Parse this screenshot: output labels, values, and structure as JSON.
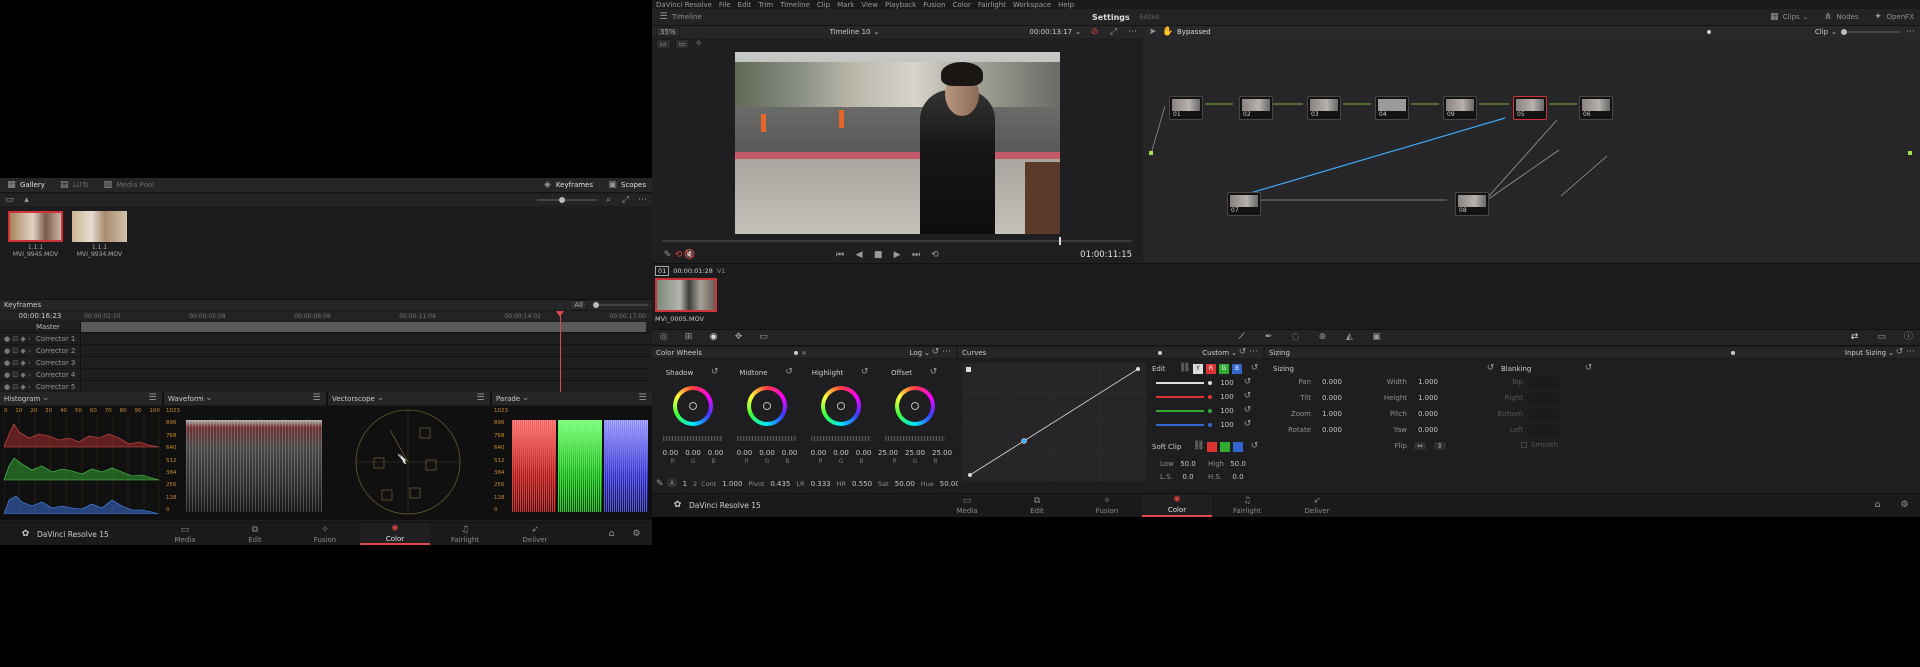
{
  "left": {
    "tabs": {
      "gallery": "Gallery",
      "luts": "LUTs",
      "media_pool": "Media Pool",
      "keyframes": "Keyframes",
      "scopes": "Scopes"
    },
    "stills": [
      {
        "version": "1.1.1",
        "name": "MVI_9945.MOV"
      },
      {
        "version": "1.1.1",
        "name": "MVI_9934.MOV"
      }
    ],
    "keyframes": {
      "title": "Keyframes",
      "filter": "All",
      "timecode": "00:00:16:23",
      "ruler": [
        "00:00:02:10",
        "00:00:05:08",
        "00:00:08:06",
        "00:00:11:04",
        "00:00:14:02",
        "00:00:17:00"
      ],
      "tracks": [
        "Master",
        "Corrector 1",
        "Corrector 2",
        "Corrector 3",
        "Corrector 4",
        "Corrector 5"
      ]
    },
    "scopes": {
      "histogram": "Histogram",
      "waveform": "Waveform",
      "vectorscope": "Vectorscope",
      "parade": "Parade",
      "hist_ticks": [
        "0",
        "10",
        "20",
        "30",
        "40",
        "50",
        "60",
        "70",
        "80",
        "90",
        "100"
      ],
      "y_ticks": [
        "1023",
        "896",
        "768",
        "640",
        "512",
        "384",
        "256",
        "128",
        "0"
      ]
    },
    "app": "DaVinci Resolve 15",
    "pages": [
      "Media",
      "Edit",
      "Fusion",
      "Color",
      "Fairlight",
      "Deliver"
    ]
  },
  "right": {
    "menu": [
      "DaVinci Resolve",
      "File",
      "Edit",
      "Trim",
      "Timeline",
      "Clip",
      "Mark",
      "View",
      "Playback",
      "Fusion",
      "Color",
      "Fairlight",
      "Workspace",
      "Help"
    ],
    "toolbar": {
      "timeline": "Timeline",
      "title": "Settings",
      "edited": "Edited",
      "clips": "Clips",
      "nodes": "Nodes",
      "openfx": "OpenFX"
    },
    "viewer": {
      "zoom": "35%",
      "timeline_name": "Timeline 10",
      "tc": "00:00:13:17",
      "timecode": "01:00:11:15"
    },
    "nodes_panel": {
      "bypassed": "Bypassed",
      "mode": "Clip",
      "nodes": [
        "01",
        "02",
        "03",
        "04",
        "09",
        "05",
        "06",
        "07",
        "08"
      ]
    },
    "clip": {
      "index": "01",
      "tc": "00:00:01:28",
      "track": "V1",
      "name": "MVI_0005.MOV"
    },
    "color_wheels": {
      "title": "Color Wheels",
      "mode": "Log",
      "wheels": [
        {
          "name": "Shadow",
          "vals": [
            "0.00",
            "0.00",
            "0.00"
          ]
        },
        {
          "name": "Midtone",
          "vals": [
            "0.00",
            "0.00",
            "0.00"
          ]
        },
        {
          "name": "Highlight",
          "vals": [
            "0.00",
            "0.00",
            "0.00"
          ]
        },
        {
          "name": "Offset",
          "vals": [
            "25.00",
            "25.00",
            "25.00"
          ]
        }
      ],
      "rgb": [
        "R",
        "G",
        "B"
      ],
      "bottom": {
        "p1": "1",
        "p2": "2",
        "cont_l": "Cont",
        "cont": "1.000",
        "pivot_l": "Pivot",
        "pivot": "0.435",
        "lr_l": "LR",
        "lr": "0.333",
        "hr_l": "HR",
        "hr": "0.550",
        "sat_l": "Sat",
        "sat": "50.00",
        "hue_l": "Hue",
        "hue": "50.00"
      }
    },
    "curves": {
      "title": "Curves",
      "mode": "Custom",
      "edit": "Edit",
      "channels": [
        "Y",
        "R",
        "G",
        "B"
      ],
      "intensity": [
        "100",
        "100",
        "100",
        "100"
      ],
      "soft_clip": "Soft Clip",
      "low_l": "Low",
      "low": "50.0",
      "high_l": "High",
      "high": "50.0",
      "ls_l": "L.S.",
      "ls": "0.0",
      "hs_l": "H.S.",
      "hs": "0.0"
    },
    "sizing": {
      "title": "Sizing",
      "mode": "Input Sizing",
      "section": "Sizing",
      "blanking": "Blanking",
      "left": [
        {
          "l": "Pan",
          "v": "0.000"
        },
        {
          "l": "Tilt",
          "v": "0.000"
        },
        {
          "l": "Zoom",
          "v": "1.000"
        },
        {
          "l": "Rotate",
          "v": "0.000"
        }
      ],
      "right": [
        {
          "l": "Width",
          "v": "1.000"
        },
        {
          "l": "Height",
          "v": "1.000"
        },
        {
          "l": "Pitch",
          "v": "0.000"
        },
        {
          "l": "Yaw",
          "v": "0.000"
        },
        {
          "l": "Flip",
          "v": ""
        }
      ],
      "blank": [
        "Top",
        "Right",
        "Bottom",
        "Left"
      ],
      "smooth": "Smooth"
    },
    "app": "DaVinci Resolve 15",
    "pages": [
      "Media",
      "Edit",
      "Fusion",
      "Color",
      "Fairlight",
      "Deliver"
    ]
  }
}
